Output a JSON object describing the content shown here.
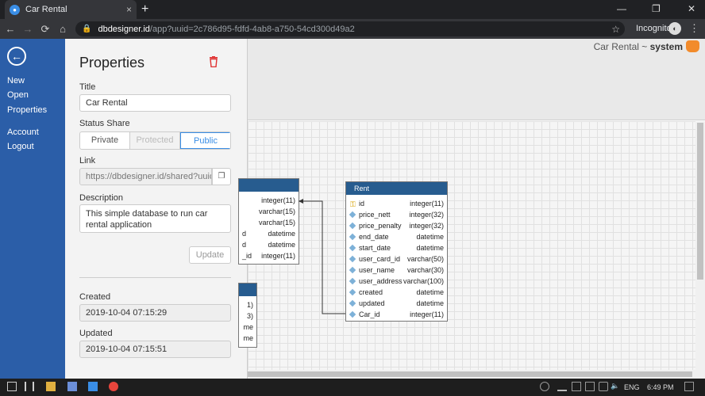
{
  "browser": {
    "tab_title": "Car Rental",
    "tab_close": "×",
    "new_tab": "+",
    "url_domain": "dbdesigner.id",
    "url_rest": "/app?uuid=2c786d95-fdfd-4ab8-a750-54cd300d49a2",
    "incognito_label": "Incognito",
    "window_minimize": "—",
    "window_restore": "❐",
    "window_close": "✕"
  },
  "sidebar": {
    "items": [
      {
        "label": "New"
      },
      {
        "label": "Open"
      },
      {
        "label": "Properties"
      },
      {
        "label": "Account"
      },
      {
        "label": "Logout"
      }
    ]
  },
  "properties": {
    "heading": "Properties",
    "title_label": "Title",
    "title_value": "Car Rental",
    "status_label": "Status Share",
    "status_options": [
      "Private",
      "Protected",
      "Public"
    ],
    "status_selected": "Public",
    "link_label": "Link",
    "link_value": "https://dbdesigner.id/shared?uuid=",
    "description_label": "Description",
    "description_value": "This simple database to run car rental application",
    "update_button": "Update",
    "created_label": "Created",
    "created_value": "2019-10-04 07:15:29",
    "updated_label": "Updated",
    "updated_value": "2019-10-04 07:15:51"
  },
  "canvas": {
    "app_title": "Car Rental ~ ",
    "app_user": "system",
    "rent_table": {
      "name": "Rent",
      "columns": [
        {
          "name": "id",
          "type": "integer(11)",
          "pk": true
        },
        {
          "name": "price_nett",
          "type": "integer(32)"
        },
        {
          "name": "price_penalty",
          "type": "integer(32)"
        },
        {
          "name": "end_date",
          "type": "datetime"
        },
        {
          "name": "start_date",
          "type": "datetime"
        },
        {
          "name": "user_card_id",
          "type": "varchar(50)"
        },
        {
          "name": "user_name",
          "type": "varchar(30)"
        },
        {
          "name": "user_address",
          "type": "varchar(100)"
        },
        {
          "name": "created",
          "type": "datetime"
        },
        {
          "name": "updated",
          "type": "datetime"
        },
        {
          "name": "Car_id",
          "type": "integer(11)"
        }
      ]
    },
    "partial_table_1": {
      "columns": [
        {
          "name": "",
          "type": "integer(11)"
        },
        {
          "name": "",
          "type": "varchar(15)"
        },
        {
          "name": "",
          "type": "varchar(15)"
        },
        {
          "name": "d",
          "type": "datetime"
        },
        {
          "name": "d",
          "type": "datetime"
        },
        {
          "name": "_id",
          "type": "integer(11)"
        }
      ]
    },
    "partial_table_2": {
      "columns": [
        {
          "type": "1)"
        },
        {
          "type": "3)"
        },
        {
          "type": "me"
        },
        {
          "type": "me"
        }
      ]
    }
  },
  "taskbar": {
    "lang": "ENG",
    "time": "6:49 PM"
  },
  "colors": {
    "sidebar": "#2b5ea8",
    "table_header": "#275c8f",
    "accent": "#3a8ee6",
    "trash": "#e03030"
  }
}
